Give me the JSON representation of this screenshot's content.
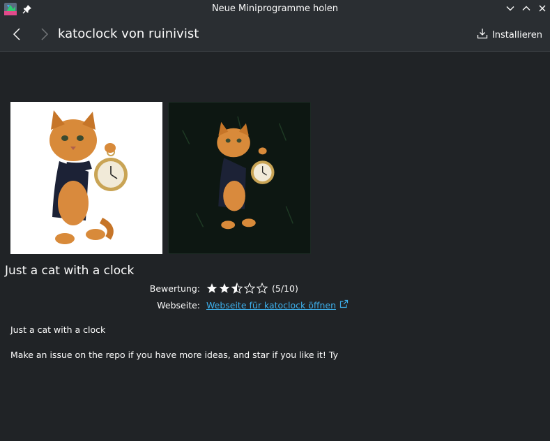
{
  "window": {
    "title": "Neue Miniprogramme holen"
  },
  "header": {
    "page_title": "katoclock von ruinivist",
    "install_label": "Installieren"
  },
  "package": {
    "name": "Just a cat with a clock",
    "rating_label": "Bewertung:",
    "rating_value": 5,
    "rating_max": 10,
    "rating_text": "(5/10)",
    "website_label": "Webseite:",
    "website_link": "Webseite für katoclock öffnen",
    "description": [
      "Just a cat with a clock",
      "Make an issue on the repo if you have more ideas, and star if you like it! Ty"
    ]
  },
  "icons": {
    "app": "kde-store-icon",
    "pin": "pin-icon",
    "back": "chevron-left-icon",
    "forward": "chevron-right-icon",
    "install": "download-icon",
    "external": "external-link-icon"
  },
  "colors": {
    "background": "#202326",
    "header": "#2a2e32",
    "link": "#3daee9",
    "text": "#fcfcfc"
  }
}
